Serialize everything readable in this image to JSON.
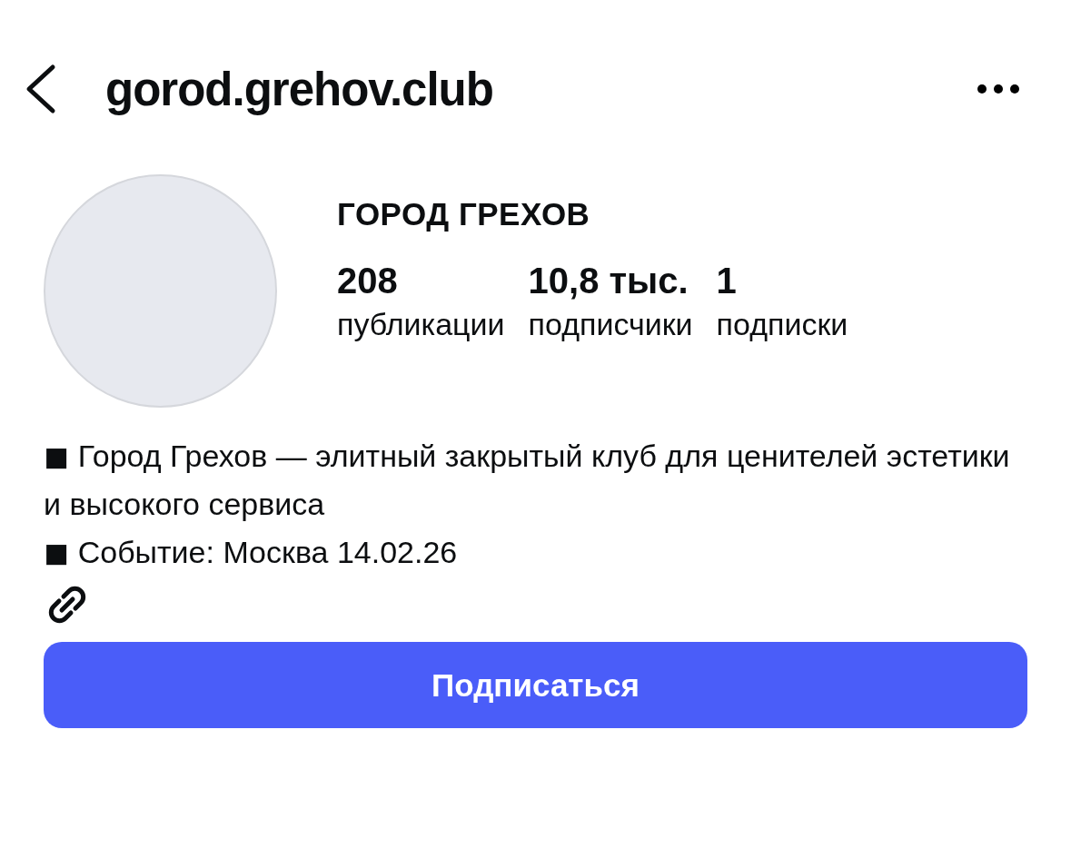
{
  "header": {
    "username": "gorod.grehov.club"
  },
  "profile": {
    "name": "ГОРОД ГРЕХОВ",
    "stats": [
      {
        "value": "208",
        "label": "публикации"
      },
      {
        "value": "10,8 тыс.",
        "label": "подписчики"
      },
      {
        "value": "1",
        "label": "подписки"
      }
    ]
  },
  "bio": [
    "◼ Город Грехов — элитный закрытый клуб для ценителей эстетики и высокого сервиса",
    "◼ Событие: Москва 14.02.26"
  ],
  "follow_button": "Подписаться"
}
